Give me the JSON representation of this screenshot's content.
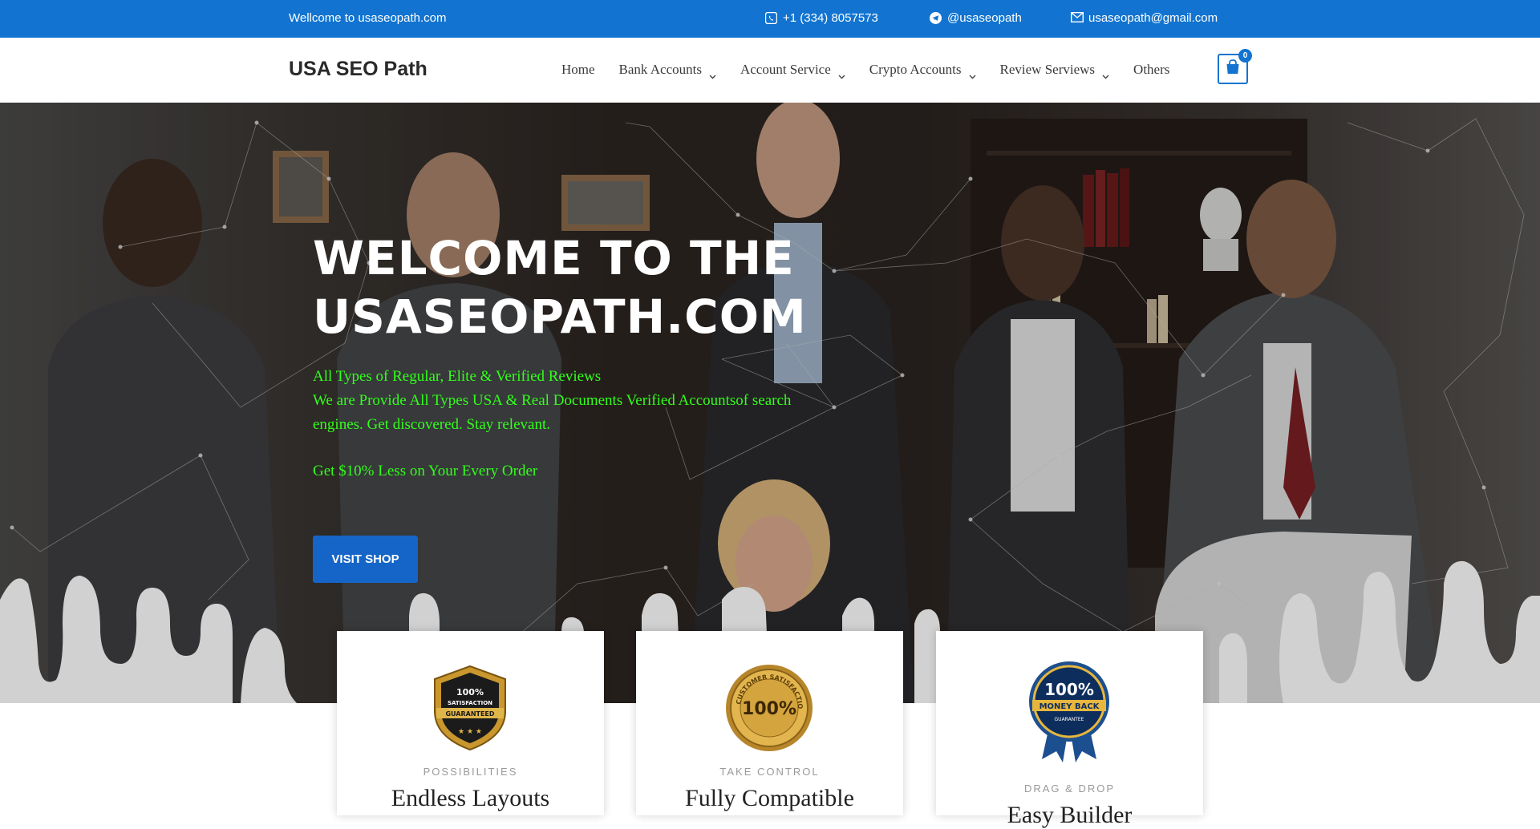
{
  "topbar": {
    "welcome": "Wellcome to usaseopath.com",
    "phone": "+1 (334) 8057573",
    "telegram": "@usaseopath",
    "email": "usaseopath@gmail.com"
  },
  "header": {
    "logo": "USA SEO Path",
    "nav": [
      {
        "label": "Home",
        "has_dropdown": false
      },
      {
        "label": "Bank Accounts",
        "has_dropdown": true
      },
      {
        "label": "Account Service",
        "has_dropdown": true
      },
      {
        "label": "Crypto Accounts",
        "has_dropdown": true
      },
      {
        "label": "Review Serviews",
        "has_dropdown": true
      },
      {
        "label": "Others",
        "has_dropdown": false
      }
    ],
    "cart_count": "0"
  },
  "hero": {
    "title_line1": "WELCOME TO THE",
    "title_line2": "USASEOPATH.COM",
    "subtitle_line1": "All Types of Regular, Elite & Verified Reviews",
    "subtitle_line2": "We are Provide All Types USA & Real Documents Verified Accountsof search engines. Get discovered. Stay relevant.",
    "offer": "Get $10% Less on Your Every Order",
    "button": "VISIT SHOP"
  },
  "features": [
    {
      "eyebrow": "POSSIBILITIES",
      "heading": "Endless Layouts",
      "badge": "satisfaction-guaranteed-badge"
    },
    {
      "eyebrow": "TAKE CONTROL",
      "heading": "Fully Compatible",
      "badge": "customer-satisfaction-100-badge"
    },
    {
      "eyebrow": "DRAG & DROP",
      "heading": "Easy Builder",
      "badge": "money-back-guarantee-badge"
    }
  ],
  "badge_text": {
    "b1_line1": "100%",
    "b1_line2": "SATISFACTION",
    "b1_line3": "GUARANTEED",
    "b2_ring": "CUSTOMER SATISFACTION",
    "b2_big": "100%",
    "b3_big": "100%",
    "b3_mid": "MONEY BACK",
    "b3_small": "GUARANTEE"
  },
  "colors": {
    "brand_blue": "#1274d0",
    "button_blue": "#1565c8",
    "hero_green": "#33ff1a"
  },
  "icons": {
    "phone": "whatsapp-icon",
    "telegram": "telegram-icon",
    "email": "envelope-icon",
    "cart": "shopping-bag-icon",
    "dropdown": "chevron-down-icon"
  }
}
